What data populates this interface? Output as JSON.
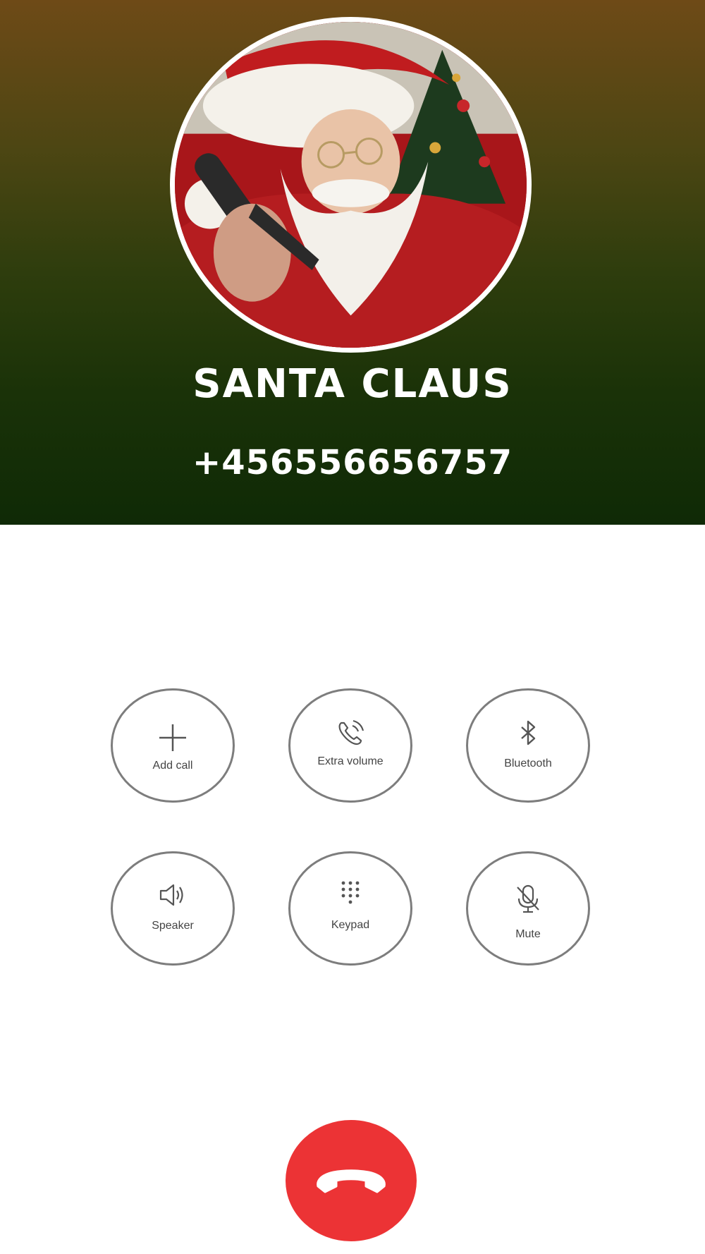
{
  "caller": {
    "name": "SANTA CLAUS",
    "number": "+456556656757"
  },
  "controls": {
    "add_call": {
      "label": "Add call",
      "icon": "plus-icon"
    },
    "extra_volume": {
      "label": "Extra volume",
      "icon": "phone-volume-icon"
    },
    "bluetooth": {
      "label": "Bluetooth",
      "icon": "bluetooth-icon"
    },
    "speaker": {
      "label": "Speaker",
      "icon": "speaker-icon"
    },
    "keypad": {
      "label": "Keypad",
      "icon": "keypad-icon"
    },
    "mute": {
      "label": "Mute",
      "icon": "mic-off-icon"
    }
  },
  "end_call": {
    "icon": "hang-up-icon",
    "color": "#ec3335"
  },
  "colors": {
    "header_top": "#6e4a17",
    "header_bottom": "#0f2a06",
    "control_border": "#7d7d7d"
  }
}
